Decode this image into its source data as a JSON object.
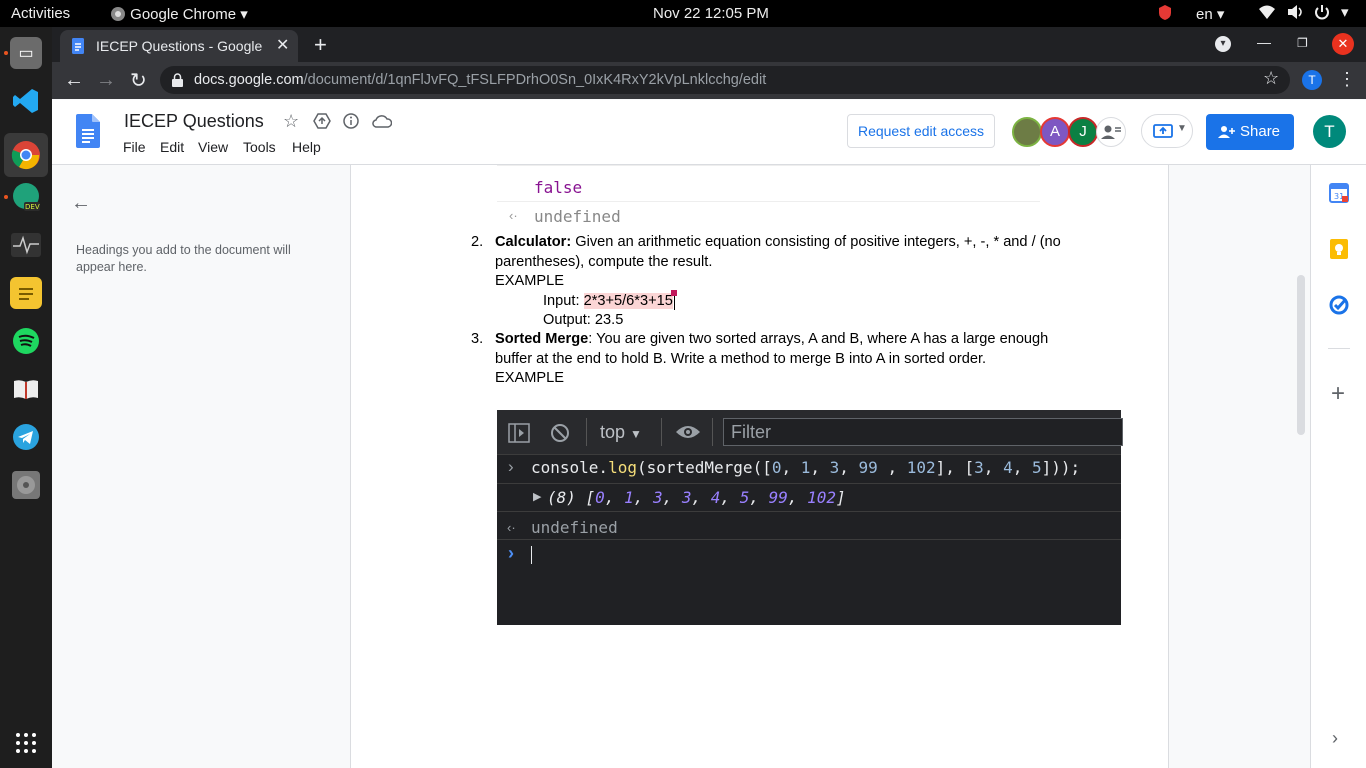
{
  "topbar": {
    "activities": "Activities",
    "app_menu": "Google Chrome ▾",
    "clock": "Nov 22  12:05 PM",
    "lang": "en ▾"
  },
  "chrome": {
    "tab_title": "IECEP Questions - Google",
    "url_host": "docs.google.com",
    "url_path": "/document/d/1qnFlJvFQ_tFSLFPDrhO0Sn_0IxK4RxY2kVpLnklcchg/edit",
    "profile_letter": "T"
  },
  "docs": {
    "title": "IECEP Questions",
    "menus": [
      "File",
      "Edit",
      "View",
      "Tools",
      "Help"
    ],
    "request_access": "Request edit access",
    "share": "Share",
    "account_letter": "T",
    "avatars": [
      "A",
      "J"
    ],
    "outline_hint": "Headings you add to the document will appear here."
  },
  "content": {
    "code_false": "false",
    "code_undefined": "undefined",
    "item2_num": "2.",
    "item2_bold": "Calculator:",
    "item2_line1": " Given an arithmetic equation consisting of positive integers, +, -, * and / (no",
    "item2_line2": "parentheses), compute the result.",
    "example": "EXAMPLE",
    "input_label": "Input: ",
    "input_value": "2*3+5/6*3+15",
    "output_line": "Output: 23.5",
    "item3_num": "3.",
    "item3_bold": "Sorted Merge",
    "item3_line1": ": You are given two sorted arrays, A and B, where A has a large enough",
    "item3_line2": "buffer at the end to hold B. Write a method to merge B into A in sorted order.",
    "example2": "EXAMPLE"
  },
  "console": {
    "context": "top",
    "filter_placeholder": "Filter",
    "command_obj": "console.",
    "command_fn": "log",
    "command_open": "(sortedMerge([",
    "arr1": [
      "0",
      "1",
      "3",
      "99",
      "102"
    ],
    "arr2": [
      "3",
      "4",
      "5"
    ],
    "result_count": "(8)",
    "result_values": [
      "0",
      "1",
      "3",
      "3",
      "4",
      "5",
      "99",
      "102"
    ],
    "undefined": "undefined"
  },
  "colors": {
    "docs_blue": "#1a73e8",
    "share_blue": "#1a73e8",
    "teal_account": "#00897b",
    "console_bg": "#202124",
    "num_cyan": "#9980ff"
  }
}
